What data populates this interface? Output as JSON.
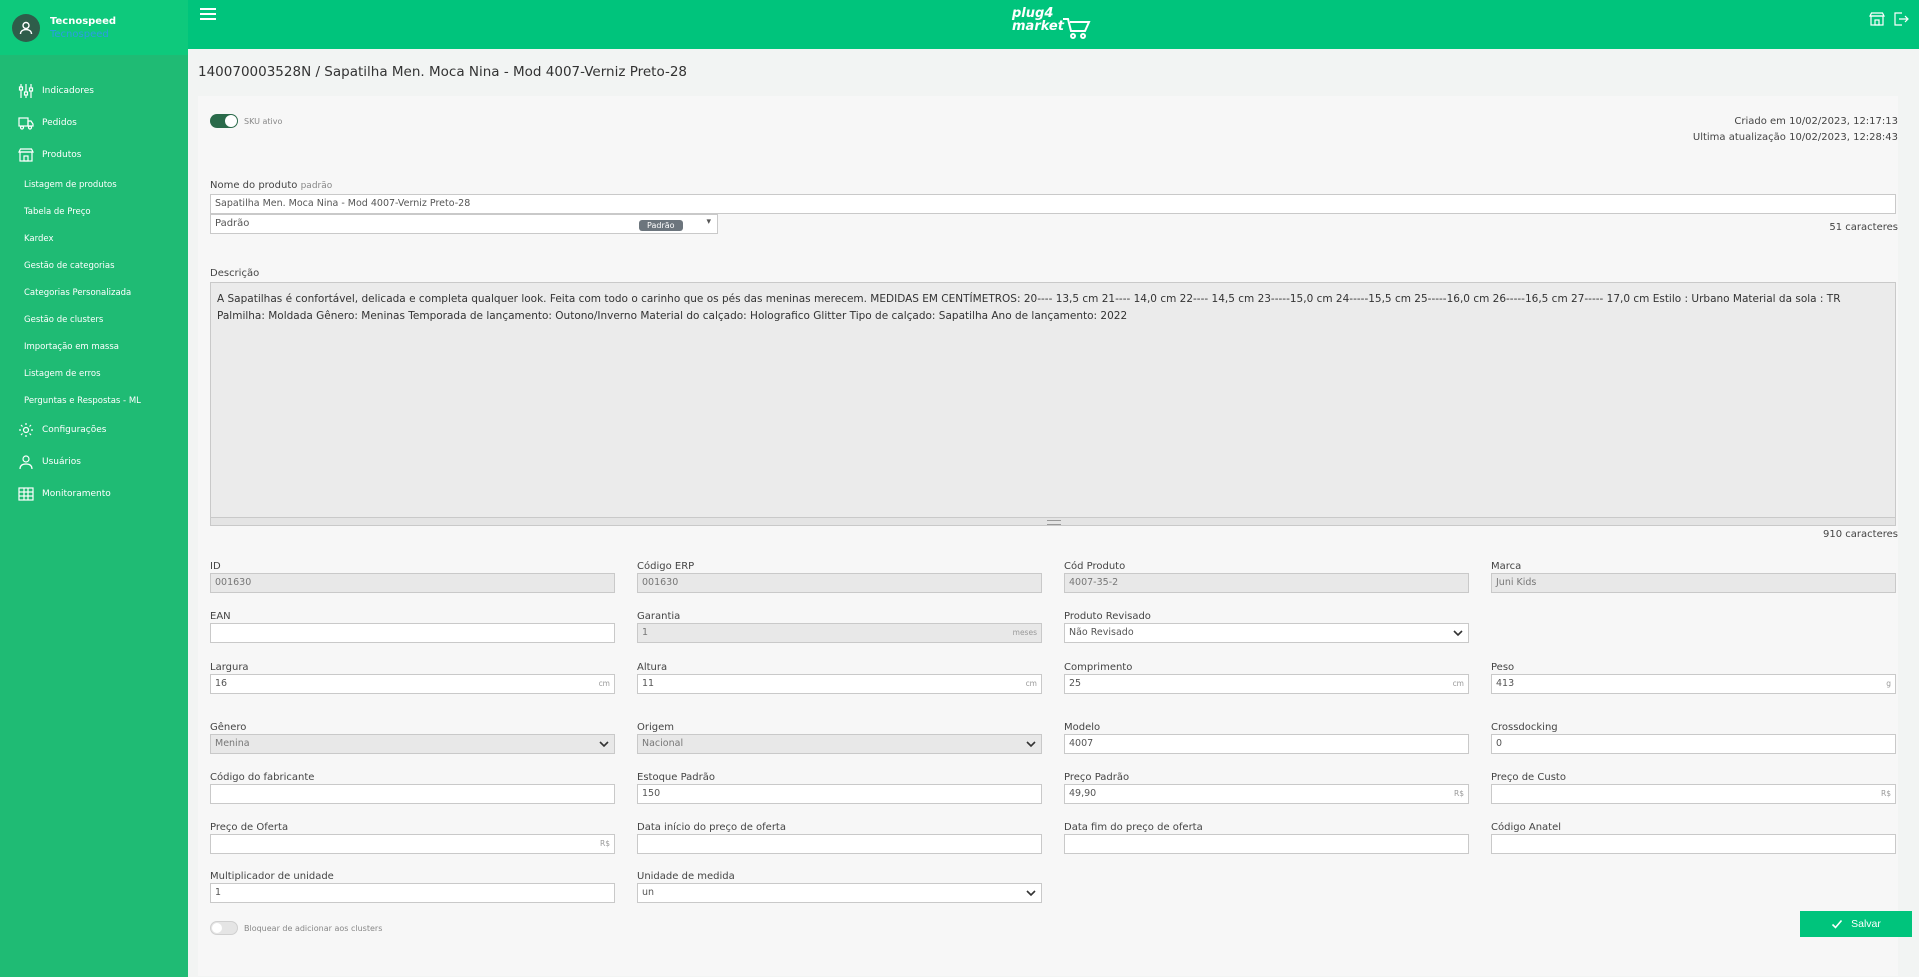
{
  "sidebar": {
    "user_name": "Tecnospeed",
    "user_company": "Tecnospeed",
    "menu": [
      {
        "label": "Indicadores",
        "icon": "sliders-icon"
      },
      {
        "label": "Pedidos",
        "icon": "truck-icon"
      },
      {
        "label": "Produtos",
        "icon": "store-icon"
      }
    ],
    "submenu": [
      "Listagem de produtos",
      "Tabela de Preço",
      "Kardex",
      "Gestão de categorias",
      "Categorias Personalizada",
      "Gestão de clusters",
      "Importação em massa",
      "Listagem de erros",
      "Perguntas e Respostas - ML"
    ],
    "menu_bottom": [
      {
        "label": "Configurações",
        "icon": "gear-icon"
      },
      {
        "label": "Usuários",
        "icon": "user-icon"
      },
      {
        "label": "Monitoramento",
        "icon": "monitor-icon"
      }
    ]
  },
  "topbar": {
    "logo_line1": "plug4",
    "logo_line2": "market"
  },
  "page": {
    "title": "140070003528N / Sapatilha Men. Moca Nina - Mod 4007-Verniz Preto-28"
  },
  "form": {
    "sku_label": "SKU ativo",
    "created": "Criado em 10/02/2023, 12:17:13",
    "updated": "Ultima atualização 10/02/2023, 12:28:43",
    "name_label": "Nome do produto",
    "name_label_small": "padrão",
    "name_value": "Sapatilha Men. Moca Nina - Mod 4007-Verniz Preto-28",
    "lang_value": "Padrão",
    "lang_badge": "Padrão",
    "name_chars": "51 caracteres",
    "desc_label": "Descrição",
    "desc_value": "A Sapatilhas é confortável, delicada e completa qualquer look. Feita com todo o carinho que os pés das meninas merecem. MEDIDAS EM CENTÍMETROS: 20---- 13,5 cm 21---- 14,0 cm 22---- 14,5 cm 23-----15,0 cm 24-----15,5 cm 25-----16,0 cm 26-----16,5 cm 27----- 17,0 cm Estilo : Urbano Material da sola : TR Palmilha: Moldada Gênero: Meninas Temporada de lançamento: Outono/Inverno Material do calçado: Holografico Glitter Tipo de calçado: Sapatilha Ano de lançamento: 2022",
    "desc_chars": "910 caracteres",
    "fields": {
      "id": {
        "label": "ID",
        "value": "001630"
      },
      "erp": {
        "label": "Código ERP",
        "value": "001630"
      },
      "cod_produto": {
        "label": "Cód Produto",
        "value": "4007-35-2"
      },
      "marca": {
        "label": "Marca",
        "value": "Juni Kids"
      },
      "ean": {
        "label": "EAN",
        "value": ""
      },
      "garantia": {
        "label": "Garantia",
        "value": "1",
        "unit": "meses"
      },
      "revisado": {
        "label": "Produto Revisado",
        "value": "Não Revisado"
      },
      "largura": {
        "label": "Largura",
        "value": "16",
        "unit": "cm"
      },
      "altura": {
        "label": "Altura",
        "value": "11",
        "unit": "cm"
      },
      "comprimento": {
        "label": "Comprimento",
        "value": "25",
        "unit": "cm"
      },
      "peso": {
        "label": "Peso",
        "value": "413",
        "unit": "g"
      },
      "genero": {
        "label": "Gênero",
        "value": "Menina"
      },
      "origem": {
        "label": "Origem",
        "value": "Nacional"
      },
      "modelo": {
        "label": "Modelo",
        "value": "4007"
      },
      "crossdocking": {
        "label": "Crossdocking",
        "value": "0"
      },
      "cod_fabricante": {
        "label": "Código do fabricante",
        "value": ""
      },
      "estoque": {
        "label": "Estoque Padrão",
        "value": "150"
      },
      "preco_padrao": {
        "label": "Preço Padrão",
        "value": "49,90",
        "unit": "R$"
      },
      "preco_custo": {
        "label": "Preço de Custo",
        "value": "",
        "unit": "R$"
      },
      "preco_oferta": {
        "label": "Preço de Oferta",
        "value": "",
        "unit": "R$"
      },
      "data_inicio": {
        "label": "Data início do preço de oferta",
        "value": ""
      },
      "data_fim": {
        "label": "Data fim do preço de oferta",
        "value": ""
      },
      "anatel": {
        "label": "Código Anatel",
        "value": ""
      },
      "multiplicador": {
        "label": "Multiplicador de unidade",
        "value": "1"
      },
      "unidade": {
        "label": "Unidade de medida",
        "value": "un"
      }
    },
    "block_label": "Bloquear de adicionar aos clusters",
    "save_label": "Salvar"
  },
  "colors": {
    "sidebar": "#1fbb74",
    "topbar": "#00c47c",
    "save_button": "#00c47c"
  }
}
